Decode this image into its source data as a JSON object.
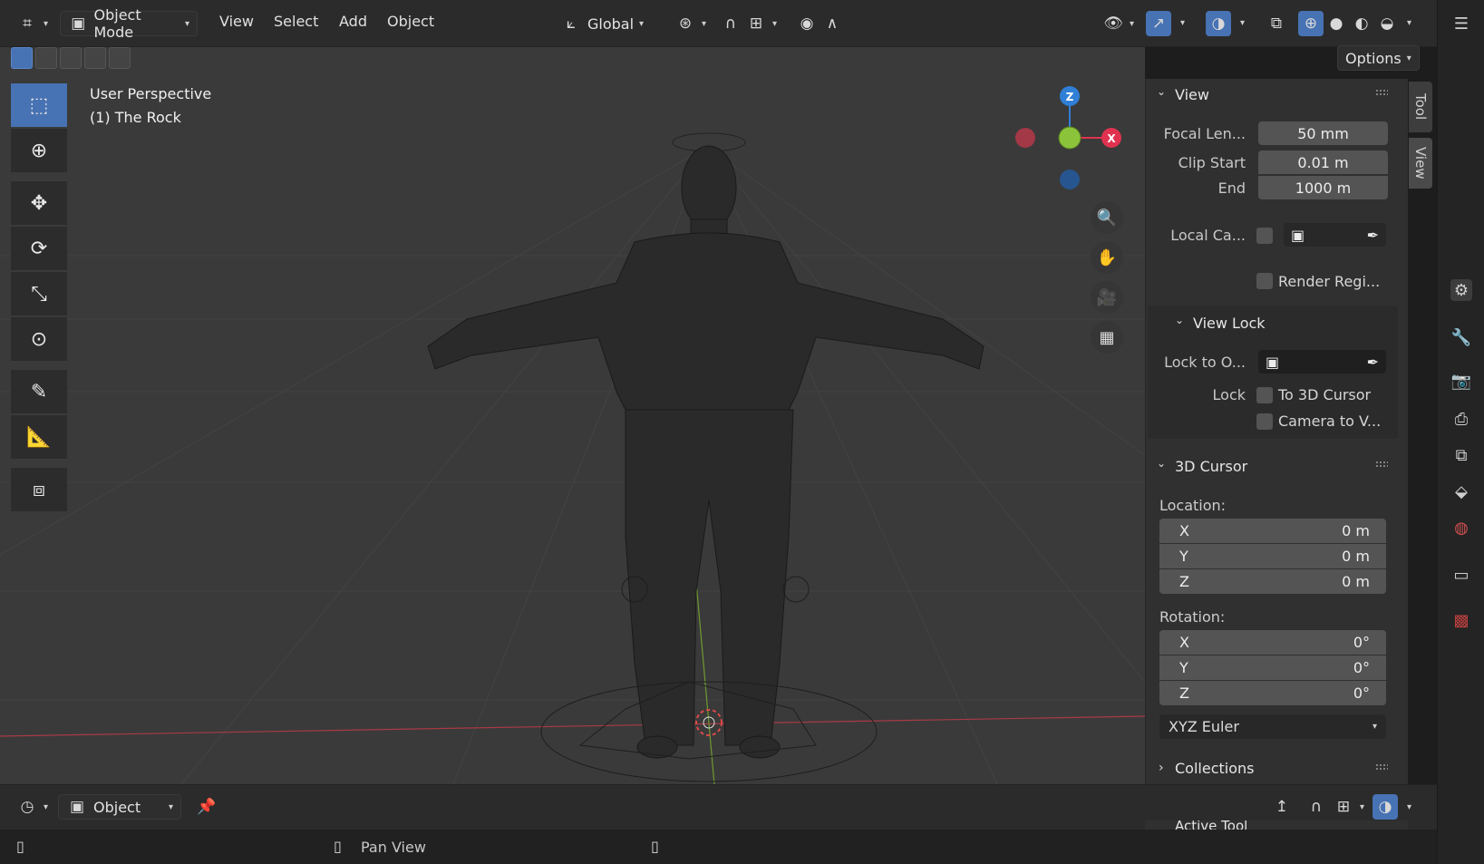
{
  "header": {
    "mode": "Object Mode",
    "menus": [
      "View",
      "Select",
      "Add",
      "Object"
    ],
    "orientation": "Global",
    "options_label": "Options"
  },
  "viewport": {
    "perspective": "User Perspective",
    "object": "(1) The Rock",
    "gizmo": {
      "z": "Z",
      "x": "X"
    }
  },
  "side_tabs": {
    "tool": "Tool",
    "view": "View"
  },
  "view_panel": {
    "title": "View",
    "focal_label": "Focal Len...",
    "focal_value": "50 mm",
    "clip_start_label": "Clip Start",
    "clip_start_value": "0.01 m",
    "clip_end_label": "End",
    "clip_end_value": "1000 m",
    "local_camera_label": "Local Ca...",
    "render_region_label": "Render Regi...",
    "view_lock_title": "View Lock",
    "lock_to_object_label": "Lock to O...",
    "lock_label": "Lock",
    "to_3d_cursor": "To 3D Cursor",
    "camera_to_view": "Camera to V..."
  },
  "cursor_panel": {
    "title": "3D Cursor",
    "location_label": "Location:",
    "location": [
      {
        "axis": "X",
        "value": "0 m"
      },
      {
        "axis": "Y",
        "value": "0 m"
      },
      {
        "axis": "Z",
        "value": "0 m"
      }
    ],
    "rotation_label": "Rotation:",
    "rotation": [
      {
        "axis": "X",
        "value": "0°"
      },
      {
        "axis": "Y",
        "value": "0°"
      },
      {
        "axis": "Z",
        "value": "0°"
      }
    ],
    "rotation_mode": "XYZ Euler"
  },
  "collections_title": "Collections",
  "active_tool_title": "Active Tool",
  "timeline": {
    "mode": "Object"
  },
  "status": {
    "pan": "Pan View"
  },
  "colors": {
    "accent": "#4772b3",
    "viewport": "#3a3a3a",
    "panel": "#303030",
    "axis_x": "#e0324f",
    "axis_y": "#8bc43a",
    "axis_z": "#2f7fd6"
  }
}
